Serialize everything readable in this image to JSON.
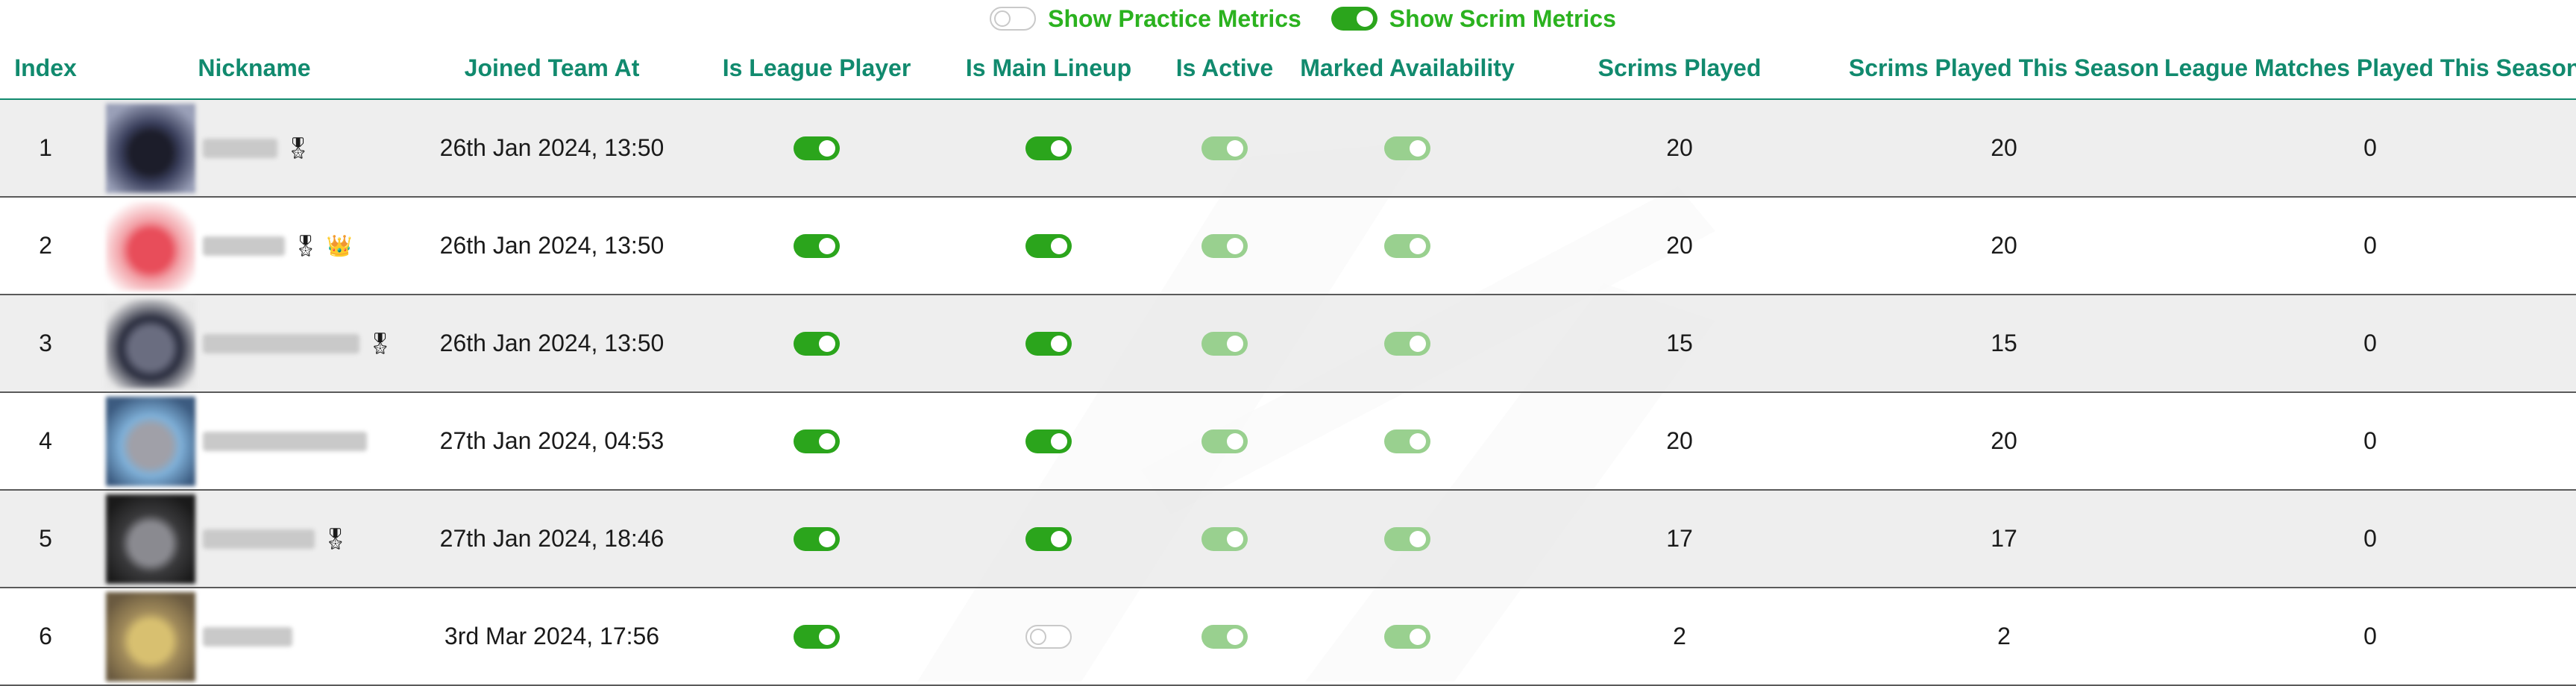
{
  "toggles": {
    "practice": {
      "label": "Show Practice Metrics",
      "on": false
    },
    "scrim": {
      "label": "Show Scrim Metrics",
      "on": true
    }
  },
  "columns": [
    "Index",
    "Nickname",
    "Joined Team At",
    "Is League Player",
    "Is Main Lineup",
    "Is Active",
    "Marked Availability",
    "Scrims Played",
    "Scrims Played This Season",
    "League Matches Played This Season"
  ],
  "colors": {
    "accent": "#118a6e",
    "toggle_on": "#2ba51c",
    "toggle_dim": "#99d08f",
    "label_green": "#2bb21f"
  },
  "rows": [
    {
      "index": "1",
      "badges": [
        "🎖"
      ],
      "joined": "26th Jan 2024, 13:50",
      "league": true,
      "main": true,
      "active": true,
      "available": true,
      "scrims": "20",
      "scrims_season": "20",
      "league_matches": "0"
    },
    {
      "index": "2",
      "badges": [
        "🎖",
        "👑"
      ],
      "joined": "26th Jan 2024, 13:50",
      "league": true,
      "main": true,
      "active": true,
      "available": true,
      "scrims": "20",
      "scrims_season": "20",
      "league_matches": "0"
    },
    {
      "index": "3",
      "badges": [
        "🎖"
      ],
      "joined": "26th Jan 2024, 13:50",
      "league": true,
      "main": true,
      "active": true,
      "available": true,
      "scrims": "15",
      "scrims_season": "15",
      "league_matches": "0"
    },
    {
      "index": "4",
      "badges": [],
      "joined": "27th Jan 2024, 04:53",
      "league": true,
      "main": true,
      "active": true,
      "available": true,
      "scrims": "20",
      "scrims_season": "20",
      "league_matches": "0"
    },
    {
      "index": "5",
      "badges": [
        "🎖"
      ],
      "joined": "27th Jan 2024, 18:46",
      "league": true,
      "main": true,
      "active": true,
      "available": true,
      "scrims": "17",
      "scrims_season": "17",
      "league_matches": "0"
    },
    {
      "index": "6",
      "badges": [],
      "joined": "3rd Mar 2024, 17:56",
      "league": true,
      "main": false,
      "active": true,
      "available": true,
      "scrims": "2",
      "scrims_season": "2",
      "league_matches": "0"
    }
  ]
}
